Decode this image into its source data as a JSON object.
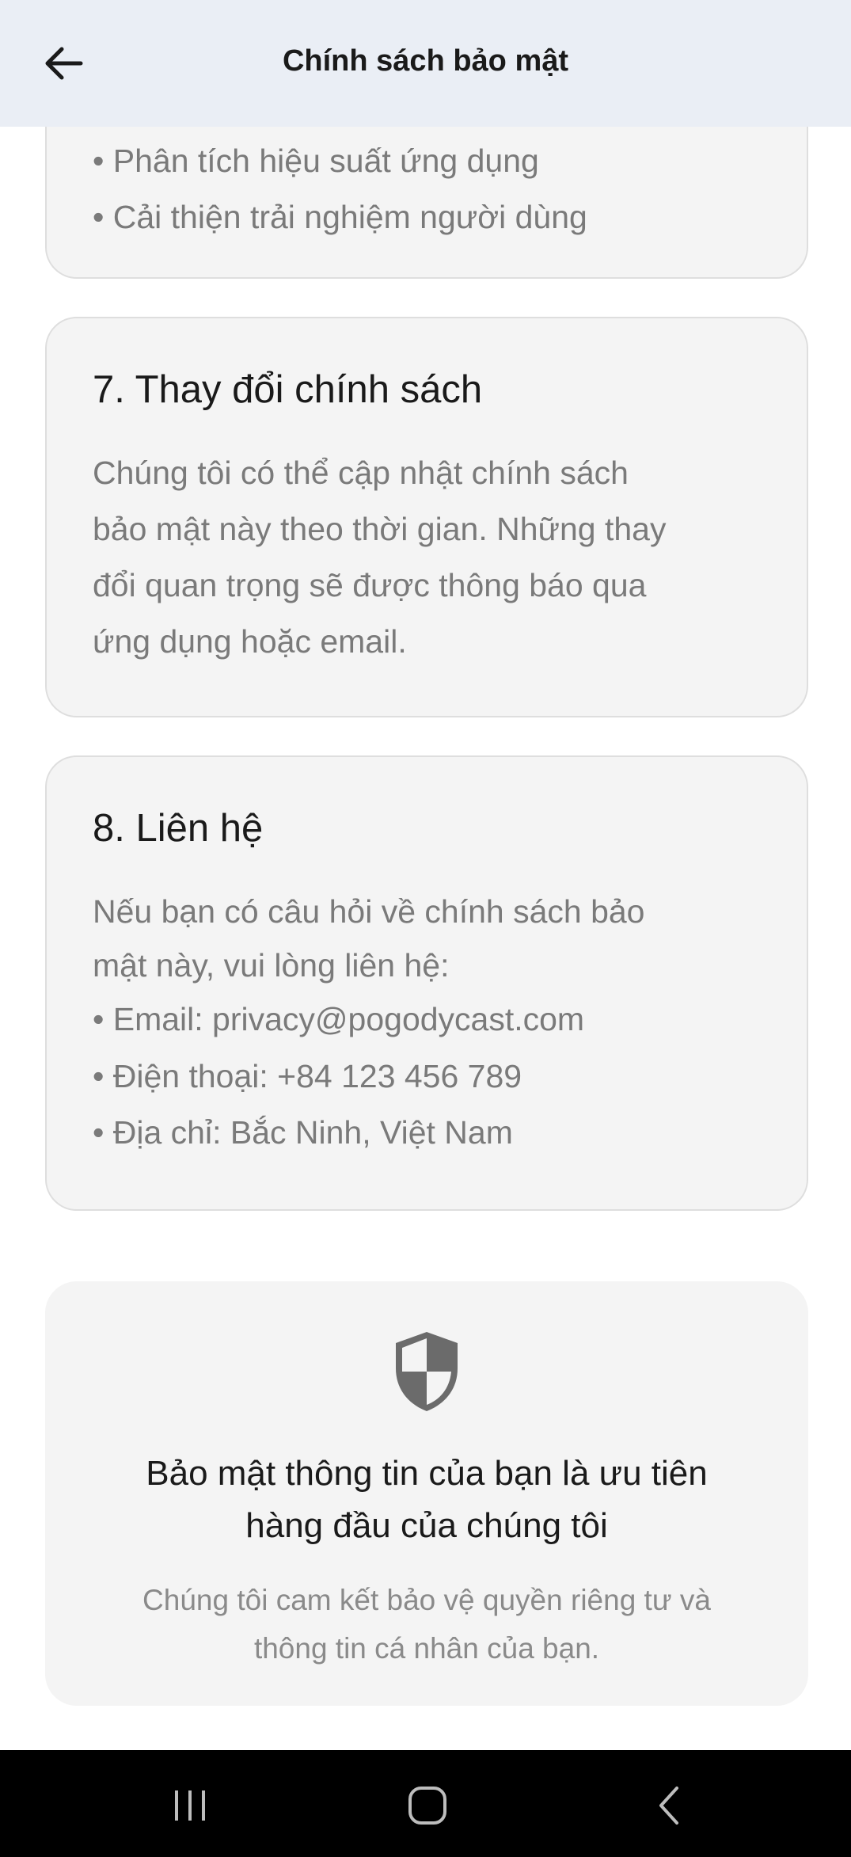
{
  "appbar": {
    "title": "Chính sách bảo mật",
    "back_icon": "arrow-left-icon"
  },
  "sections": {
    "s6": {
      "bullets": [
        "• Phân tích hiệu suất ứng dụng",
        "• Cải thiện trải nghiệm người dùng"
      ]
    },
    "s7": {
      "title": "7. Thay đổi chính sách",
      "lines": [
        "Chúng tôi có thể cập nhật chính sách",
        "bảo mật này theo thời gian. Những thay",
        "đổi quan trọng sẽ được thông báo qua",
        "ứng dụng hoặc email."
      ]
    },
    "s8": {
      "title": "8. Liên hệ",
      "lines": [
        "Nếu bạn có câu hỏi về chính sách bảo",
        "mật này, vui lòng liên hệ:"
      ],
      "bullets": [
        "• Email: privacy@pogodycast.com",
        "• Điện thoại: +84 123 456 789",
        "• Địa chỉ: Bắc Ninh, Việt Nam"
      ]
    }
  },
  "summary": {
    "icon": "shield-icon",
    "title_lines": [
      "Bảo mật thông tin của bạn là ưu tiên",
      "hàng đầu của chúng tôi"
    ],
    "sub_lines": [
      "Chúng tôi cam kết bảo vệ quyền riêng tư và",
      "thông tin cá nhân của bạn."
    ]
  },
  "navbar": {
    "recents_icon": "recent-apps-icon",
    "home_icon": "home-icon",
    "back_icon": "back-chevron-icon"
  },
  "colors": {
    "appbar_bg": "#eaeef5",
    "card_bg": "#f4f4f4",
    "title_text": "#1a1a1a",
    "body_text": "#7a7a7a",
    "shield": "#6b6b6b",
    "navbar_bg": "#000000"
  }
}
